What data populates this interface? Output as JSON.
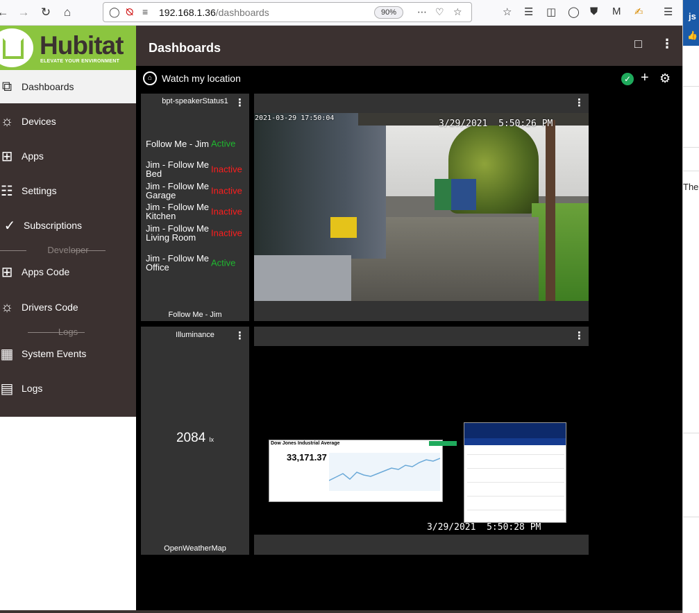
{
  "browser": {
    "url_host": "192.168.1.36",
    "url_path": "/dashboards",
    "zoom": "90%"
  },
  "side_window": {
    "badge": "js",
    "text": "Ther"
  },
  "sidebar": {
    "brand": "Hubitat",
    "tagline": "ELEVATE YOUR ENVIRONMENT",
    "items": [
      {
        "label": "Dashboards",
        "icon": "dashboards-icon"
      },
      {
        "label": "Devices",
        "icon": "bulb-icon"
      },
      {
        "label": "Apps",
        "icon": "apps-icon"
      },
      {
        "label": "Settings",
        "icon": "sliders-icon"
      },
      {
        "label": "Subscriptions",
        "icon": "check-icon"
      },
      {
        "label": "Apps Code",
        "icon": "apps-code-icon"
      },
      {
        "label": "Drivers Code",
        "icon": "bulb-icon"
      },
      {
        "label": "System Events",
        "icon": "calendar-icon"
      },
      {
        "label": "Logs",
        "icon": "document-icon"
      }
    ],
    "sections": {
      "developer": "Developer",
      "logs": "Logs"
    }
  },
  "header": {
    "title": "Dashboards"
  },
  "dashboard": {
    "name": "Watch my location",
    "tiles": {
      "follow_me": {
        "title": "bpt-speakerStatus1",
        "footer": "Follow Me - Jim",
        "rows": [
          {
            "name": "Follow Me - Jim",
            "status": "Active"
          },
          {
            "name": "Jim - Follow Me Bed",
            "status": "Inactive"
          },
          {
            "name": "Jim - Follow Me Garage",
            "status": "Inactive"
          },
          {
            "name": "Jim - Follow Me Kitchen",
            "status": "Inactive"
          },
          {
            "name": "Jim - Follow Me Living Room",
            "status": "Inactive"
          },
          {
            "name": "Jim - Follow Me Office",
            "status": "Active"
          }
        ]
      },
      "camera": {
        "overlay_date": "2021-03-29 17:50:04",
        "overlay_time": "3/29/2021  5:50:26 PM"
      },
      "illuminance": {
        "title": "Illuminance",
        "value": "2084",
        "unit": "lx",
        "footer": "OpenWeatherMap"
      },
      "web": {
        "djia_title": "Dow Jones Industrial Average",
        "djia_value": "33,171.37",
        "timestamp": "3/29/2021  5:50:28 PM"
      }
    }
  },
  "colors": {
    "brand_green": "#8bc53f",
    "panel_brown": "#3b3130",
    "active": "#1fb82f",
    "inactive": "#ff1e1e"
  }
}
